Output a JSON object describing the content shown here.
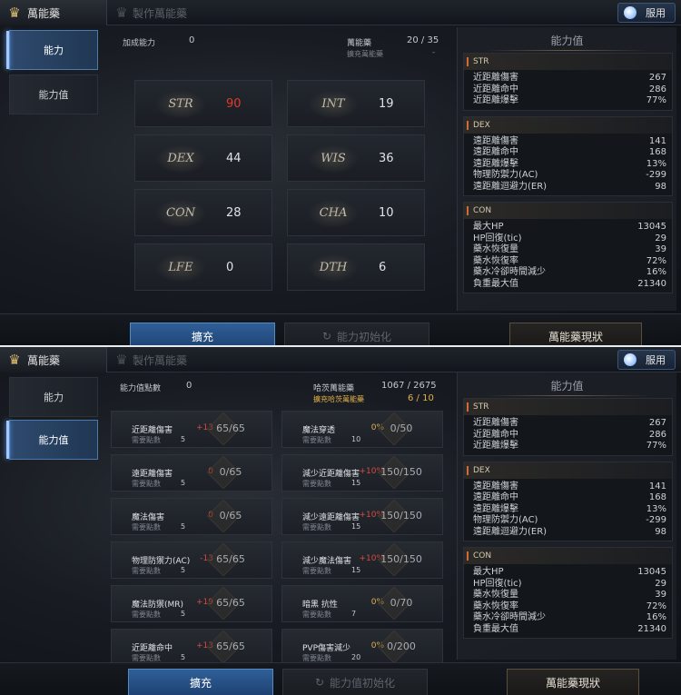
{
  "header": {
    "tab_active": "萬能藥",
    "tab_inactive": "製作萬能藥",
    "use_button": "服用"
  },
  "nav": {
    "ability": "能力",
    "ability_value": "能力值"
  },
  "panel1": {
    "added_label": "加成能力",
    "added_value": "0",
    "elixir_label": "萬能藥",
    "elixir_value": "20 / 35",
    "expand_label": "擴充萬能藥",
    "expand_value": "-",
    "stats": [
      {
        "name": "STR",
        "value": "90",
        "red": true
      },
      {
        "name": "INT",
        "value": "19"
      },
      {
        "name": "DEX",
        "value": "44"
      },
      {
        "name": "WIS",
        "value": "36"
      },
      {
        "name": "CON",
        "value": "28"
      },
      {
        "name": "CHA",
        "value": "10"
      },
      {
        "name": "LFE",
        "value": "0"
      },
      {
        "name": "DTH",
        "value": "6"
      }
    ]
  },
  "panel2": {
    "points_label": "能力值點數",
    "points_value": "0",
    "hayan_label": "哈茨萬能藥",
    "hayan_value": "1067 / 2675",
    "hayan_expand_label": "擴充哈茨萬能藥",
    "hayan_expand_value": "6 / 10",
    "need_label": "需要點數",
    "cards": [
      {
        "name": "近距離傷害",
        "bonus": "+13",
        "frac": "65/65",
        "need": "5"
      },
      {
        "name": "魔法穿透",
        "bonus": "0%",
        "frac": "0/50",
        "need": "10",
        "gold": true
      },
      {
        "name": "遠距離傷害",
        "bonus": "0",
        "frac": "0/65",
        "need": "5"
      },
      {
        "name": "減少近距離傷害",
        "bonus": "+10%",
        "frac": "150/150",
        "need": "15"
      },
      {
        "name": "魔法傷害",
        "bonus": "0",
        "frac": "0/65",
        "need": "5"
      },
      {
        "name": "減少遠距離傷害",
        "bonus": "+10%",
        "frac": "150/150",
        "need": "15"
      },
      {
        "name": "物理防禦力(AC)",
        "bonus": "-13",
        "frac": "65/65",
        "need": "5"
      },
      {
        "name": "減少魔法傷害",
        "bonus": "+10%",
        "frac": "150/150",
        "need": "15"
      },
      {
        "name": "魔法防禦(MR)",
        "bonus": "+19",
        "frac": "65/65",
        "need": "5"
      },
      {
        "name": "暗黑 抗性",
        "bonus": "0%",
        "frac": "0/70",
        "need": "7",
        "gold": true
      },
      {
        "name": "近距離命中",
        "bonus": "+13",
        "frac": "65/65",
        "need": "5"
      },
      {
        "name": "PVP傷害減少",
        "bonus": "0%",
        "frac": "0/200",
        "need": "20",
        "gold": true
      }
    ]
  },
  "right_panel": {
    "title": "能力值",
    "sections": [
      {
        "head": "STR",
        "rows": [
          [
            "近距離傷害",
            "267"
          ],
          [
            "近距離命中",
            "286"
          ],
          [
            "近距離爆擊",
            "77%"
          ]
        ]
      },
      {
        "head": "DEX",
        "rows": [
          [
            "遠距離傷害",
            "141"
          ],
          [
            "遠距離命中",
            "168"
          ],
          [
            "遠距離爆擊",
            "13%"
          ],
          [
            "物理防禦力(AC)",
            "-299"
          ],
          [
            "遠距離迴避力(ER)",
            "98"
          ]
        ]
      },
      {
        "head": "CON",
        "rows": [
          [
            "最大HP",
            "13045"
          ],
          [
            "HP回復(tic)",
            "29"
          ],
          [
            "藥水恢復量",
            "39"
          ],
          [
            "藥水恢復率",
            "72%"
          ],
          [
            "藥水冷卻時間減少",
            "16%"
          ],
          [
            "負重最大值",
            "21340"
          ]
        ]
      }
    ]
  },
  "bottom": {
    "expand": "擴充",
    "reset1": "能力初始化",
    "reset2": "能力值初始化",
    "status": "萬能藥現狀"
  }
}
